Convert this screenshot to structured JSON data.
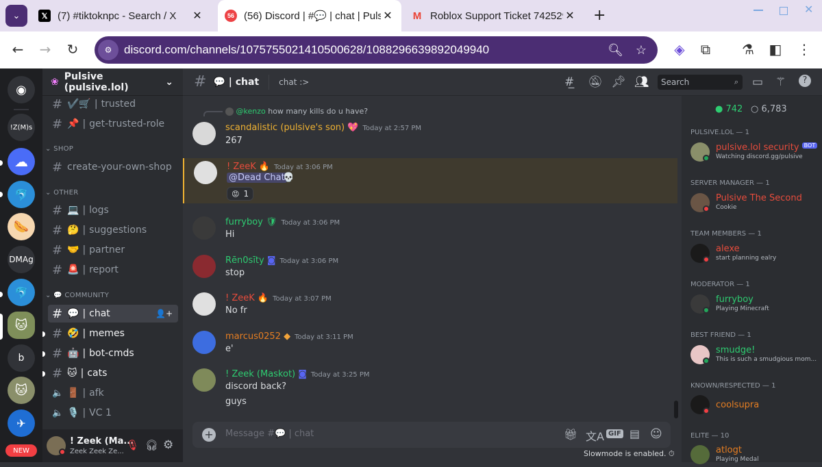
{
  "browser": {
    "tabs": [
      {
        "title": "(7) #tiktoknpc - Search / X",
        "favicon": "x-logo-icon"
      },
      {
        "title": "(56) Discord | #💬 | chat | Pulsive",
        "favicon": "discord-icon",
        "badge": "56"
      },
      {
        "title": "Roblox Support Ticket 7425296",
        "favicon": "gmail-icon"
      }
    ],
    "url": "discord.com/channels/1075755021410500628/1088296639892049940"
  },
  "guild": {
    "name": "Pulsive (pulsive.lol)",
    "server_labels": [
      "!Z(M)s",
      "DMAg",
      "b"
    ],
    "new_badge": "NEW"
  },
  "channels": {
    "top": [
      {
        "icon": "✔️🛒",
        "name": "trusted"
      },
      {
        "icon": "📌",
        "name": "get-trusted-role"
      }
    ],
    "categories": [
      {
        "name": "SHOP",
        "items": [
          {
            "icon": "",
            "name": "create-your-own-shop"
          }
        ]
      },
      {
        "name": "OTHER",
        "items": [
          {
            "icon": "💻",
            "name": "logs"
          },
          {
            "icon": "🤔",
            "name": "suggestions"
          },
          {
            "icon": "🤝",
            "name": "partner"
          },
          {
            "icon": "🚨",
            "name": "report"
          }
        ]
      },
      {
        "name": "💬 COMMUNITY",
        "items": [
          {
            "icon": "💬",
            "name": "chat"
          },
          {
            "icon": "🤣",
            "name": "memes"
          },
          {
            "icon": "🤖",
            "name": "bot-cmds"
          },
          {
            "icon": "🐱",
            "name": "cats"
          },
          {
            "icon": "🚪",
            "name": "afk"
          },
          {
            "icon": "🎙️",
            "name": "VC 1"
          }
        ]
      }
    ]
  },
  "user_panel": {
    "name": "! Zeek (Ma...",
    "status": "Zeek Zeek Ze..."
  },
  "chat": {
    "channel": "💬 | chat",
    "topic": "chat :>",
    "search_placeholder": "Search",
    "input_placeholder": "Message #💬 | chat",
    "slowmode": "Slowmode is enabled.",
    "messages": [
      {
        "reply_user": "@kenzo",
        "reply_text": "how many kills do u have?",
        "author": "scandalistic (pulsive's son)",
        "time": "Today at 2:57 PM",
        "lines": [
          "267"
        ],
        "color": "#f0b232"
      },
      {
        "author": "! ZeeK",
        "time": "Today at 3:06 PM",
        "mention": "@Dead Chat",
        "reaction_count": "1",
        "color": "#e74c3c"
      },
      {
        "author": "furryboy",
        "time": "Today at 3:06 PM",
        "lines": [
          "Hi"
        ],
        "color": "#2ecc71"
      },
      {
        "author": "Rēn0sīty",
        "time": "Today at 3:06 PM",
        "lines": [
          "stop"
        ],
        "color": "#2ecc71"
      },
      {
        "author": "! ZeeK",
        "time": "Today at 3:07 PM",
        "lines": [
          "No fr"
        ],
        "color": "#e74c3c"
      },
      {
        "author": "marcus0252",
        "time": "Today at 3:11 PM",
        "lines": [
          "e'"
        ],
        "color": "#e67e22"
      },
      {
        "author": "! Zeek (Maskot)",
        "time": "Today at 3:25 PM",
        "lines": [
          "discord back?",
          "guys"
        ],
        "color": "#2ecc71"
      }
    ]
  },
  "members": {
    "online": "742",
    "total": "6,783",
    "groups": [
      {
        "title": "PULSIVE.LOL — 1",
        "name": "pulsive.lol security",
        "bot": "BOT",
        "activity": "Watching discord.gg/pulsive",
        "color": "#e74c3c"
      },
      {
        "title": "SERVER MANAGER — 1",
        "name": "Pulsive The Second",
        "activity": "Cookie",
        "color": "#e74c3c"
      },
      {
        "title": "TEAM MEMBERS — 1",
        "name": "alexe",
        "activity": "start planning ealry",
        "color": "#e74c3c"
      },
      {
        "title": "MODERATOR — 1",
        "name": "furryboy",
        "activity": "Playing Minecraft",
        "color": "#2ecc71"
      },
      {
        "title": "BEST FRIEND — 1",
        "name": "smudge!",
        "activity": "This is such a smudgious mom...",
        "color": "#2ecc71"
      },
      {
        "title": "KNOWN/RESPECTED — 1",
        "name": "coolsupra",
        "activity": "",
        "color": "#e67e22"
      },
      {
        "title": "ELITE — 10",
        "name": "atlogt",
        "activity": "Playing Medal",
        "color": "#e67e22"
      }
    ]
  },
  "colors": {
    "accent": "#5865f2",
    "online": "#23a55a",
    "dnd": "#f23f43",
    "highlight": "#3f3a2e"
  }
}
